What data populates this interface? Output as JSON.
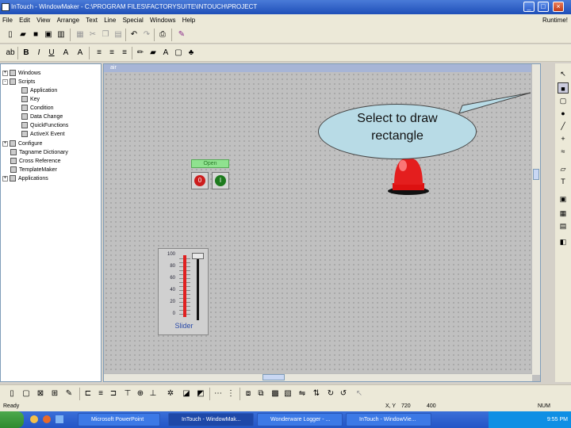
{
  "window": {
    "title": "InTouch - WindowMaker - C:\\PROGRAM FILES\\FACTORYSUITE\\INTOUCH\\PROJECT",
    "min_label": "_",
    "max_label": "□",
    "close_label": "×"
  },
  "menu": {
    "items": [
      "File",
      "Edit",
      "View",
      "Arrange",
      "Text",
      "Line",
      "Special",
      "Windows",
      "Help"
    ],
    "runtime": "Runtime!"
  },
  "tree": {
    "items": [
      {
        "label": "Windows",
        "level": 0,
        "expand": "+"
      },
      {
        "label": "Scripts",
        "level": 0,
        "expand": "-"
      },
      {
        "label": "Application",
        "level": 1,
        "expand": ""
      },
      {
        "label": "Key",
        "level": 1,
        "expand": ""
      },
      {
        "label": "Condition",
        "level": 1,
        "expand": ""
      },
      {
        "label": "Data Change",
        "level": 1,
        "expand": ""
      },
      {
        "label": "QuickFunctions",
        "level": 1,
        "expand": ""
      },
      {
        "label": "ActiveX Event",
        "level": 1,
        "expand": ""
      },
      {
        "label": "Configure",
        "level": 0,
        "expand": "+"
      },
      {
        "label": "Tagname Dictionary",
        "level": 0,
        "expand": ""
      },
      {
        "label": "Cross Reference",
        "level": 0,
        "expand": ""
      },
      {
        "label": "TemplateMaker",
        "level": 0,
        "expand": ""
      },
      {
        "label": "Applications",
        "level": 0,
        "expand": "+"
      }
    ]
  },
  "canvas": {
    "window_name": "air",
    "open_label": "Open",
    "stop_button_label": "0",
    "start_button_label": "I",
    "slider": {
      "ticks": [
        "100",
        "80",
        "60",
        "40",
        "20",
        "0"
      ],
      "caption": "Slider",
      "level": 1.0
    },
    "callout": {
      "line1": "Select to draw",
      "line2": "rectangle"
    }
  },
  "status": {
    "ready": "Ready",
    "xy_label": "X, Y",
    "x_value": "720",
    "y_value": "400",
    "num": "NUM"
  },
  "taskbar": {
    "tasks": [
      "Microsoft PowerPoint",
      "InTouch - WindowMak...",
      "Wonderware Logger - ...",
      "InTouch - WindowVie..."
    ],
    "clock": "9:55 PM"
  },
  "colors": {
    "accent": "#2355c6",
    "canvas": "#c0c0c0",
    "callout": "#b8dbe6",
    "alarm_red": "#e41e1e"
  }
}
